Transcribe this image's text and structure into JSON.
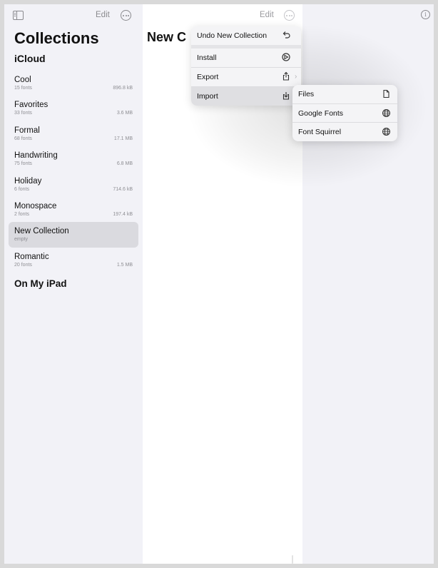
{
  "sidebar": {
    "edit_label": "Edit",
    "title": "Collections",
    "icloud_header": "iCloud",
    "items": [
      {
        "name": "Cool",
        "count": "15 fonts",
        "size": "896.8 kB"
      },
      {
        "name": "Favorites",
        "count": "33 fonts",
        "size": "3.6 MB"
      },
      {
        "name": "Formal",
        "count": "68 fonts",
        "size": "17.1 MB"
      },
      {
        "name": "Handwriting",
        "count": "75 fonts",
        "size": "6.8 MB"
      },
      {
        "name": "Holiday",
        "count": "6 fonts",
        "size": "714.6 kB"
      },
      {
        "name": "Monospace",
        "count": "2 fonts",
        "size": "197.4 kB"
      },
      {
        "name": "New Collection",
        "count": "empty",
        "size": ""
      },
      {
        "name": "Romantic",
        "count": "20 fonts",
        "size": "1.5 MB"
      }
    ],
    "selected_index": 6,
    "ipad_header": "On My iPad"
  },
  "middle": {
    "title": "New C",
    "edit_label": "Edit"
  },
  "menu": {
    "undo_label": "Undo New Collection",
    "install_label": "Install",
    "export_label": "Export",
    "import_label": "Import"
  },
  "submenu": {
    "files_label": "Files",
    "google_label": "Google Fonts",
    "squirrel_label": "Font Squirrel"
  },
  "icons": {
    "sidebar_toggle": "sidebar-toggle-icon",
    "more": "ellipsis-circle-icon",
    "info": "info-circle-icon",
    "undo": "undo-arrow-icon",
    "install": "install-badge-icon",
    "export": "share-icon",
    "import": "tray-download-icon",
    "file": "document-icon",
    "globe": "globe-icon"
  }
}
